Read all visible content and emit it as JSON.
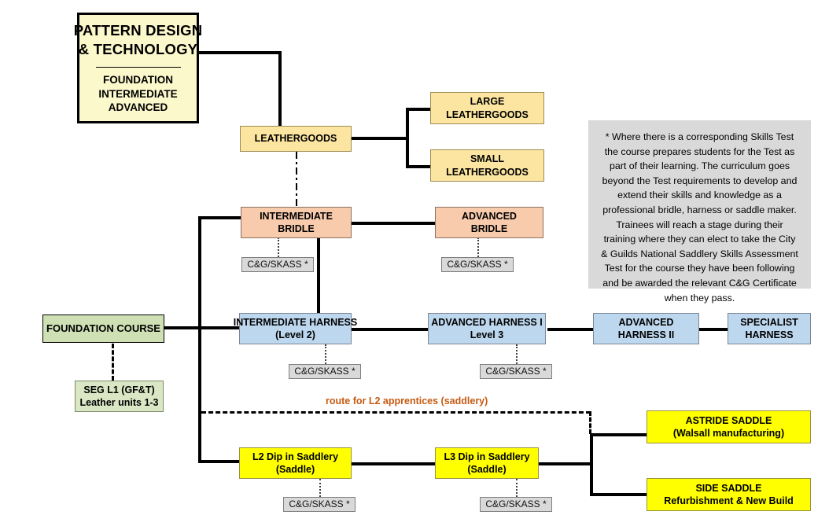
{
  "diagram": {
    "title_box": {
      "heading_line1": "PATTERN DESIGN",
      "heading_line2": "& TECHNOLOGY",
      "sub1": "FOUNDATION",
      "sub2": "INTERMEDIATE",
      "sub3": "ADVANCED"
    },
    "nodes": {
      "leathergoods": {
        "line1": "LEATHERGOODS"
      },
      "large_leathergoods": {
        "line1": "LARGE",
        "line2": "LEATHERGOODS"
      },
      "small_leathergoods": {
        "line1": "SMALL",
        "line2": "LEATHERGOODS"
      },
      "intermediate_bridle": {
        "line1": "INTERMEDIATE",
        "line2": "BRIDLE"
      },
      "advanced_bridle": {
        "line1": "ADVANCED",
        "line2": "BRIDLE"
      },
      "foundation_course": {
        "line1": "FOUNDATION COURSE"
      },
      "seg_l1": {
        "line1": "SEG L1 (GF&T)",
        "line2": "Leather units 1-3"
      },
      "intermediate_harness": {
        "line1": "INTERMEDIATE HARNESS",
        "line2": "(Level 2)"
      },
      "advanced_harness_1": {
        "line1": "ADVANCED HARNESS I",
        "line2": "Level 3"
      },
      "advanced_harness_2": {
        "line1": "ADVANCED",
        "line2": "HARNESS II"
      },
      "specialist_harness": {
        "line1": "SPECIALIST",
        "line2": "HARNESS"
      },
      "l2_dip": {
        "line1": "L2 Dip in Saddlery",
        "line2": "(Saddle)"
      },
      "l3_dip": {
        "line1": "L3 Dip in Saddlery",
        "line2": "(Saddle)"
      },
      "astride_saddle": {
        "line1": "ASTRIDE SADDLE",
        "line2": "(Walsall manufacturing)"
      },
      "side_saddle": {
        "line1": "SIDE SADDLE",
        "line2": "Refurbishment & New Build"
      }
    },
    "badges": {
      "bridge_intermediate": "C&G/SKASS *",
      "bridge_advanced": "C&G/SKASS *",
      "harness_intermediate": "C&G/SKASS *",
      "harness_advanced": "C&G/SKASS *",
      "l2_dip": "C&G/SKASS *",
      "l3_dip": "C&G/SKASS *"
    },
    "route_label": "route for L2 apprentices (saddlery)",
    "note": "* Where there is a corresponding Skills Test the course prepares students for the Test as part of their learning. The curriculum goes beyond the Test requirements to develop and extend their skills and knowledge as a professional bridle, harness or saddle maker.  Trainees will reach a stage during their training where they can elect to take the City & Guilds National Saddlery Skills Assessment Test for the course they have been following and be awarded the relevant C&G Certificate when they pass.",
    "colors": {
      "cream": "#fbf8cc",
      "gold": "#fbe5a0",
      "peach": "#f8cbad",
      "blue": "#bdd7ee",
      "green": "#cfe0b4",
      "yellow": "#ffff00",
      "grey": "#d9d9d9",
      "route_orange": "#c55a11",
      "line": "#000000"
    }
  }
}
